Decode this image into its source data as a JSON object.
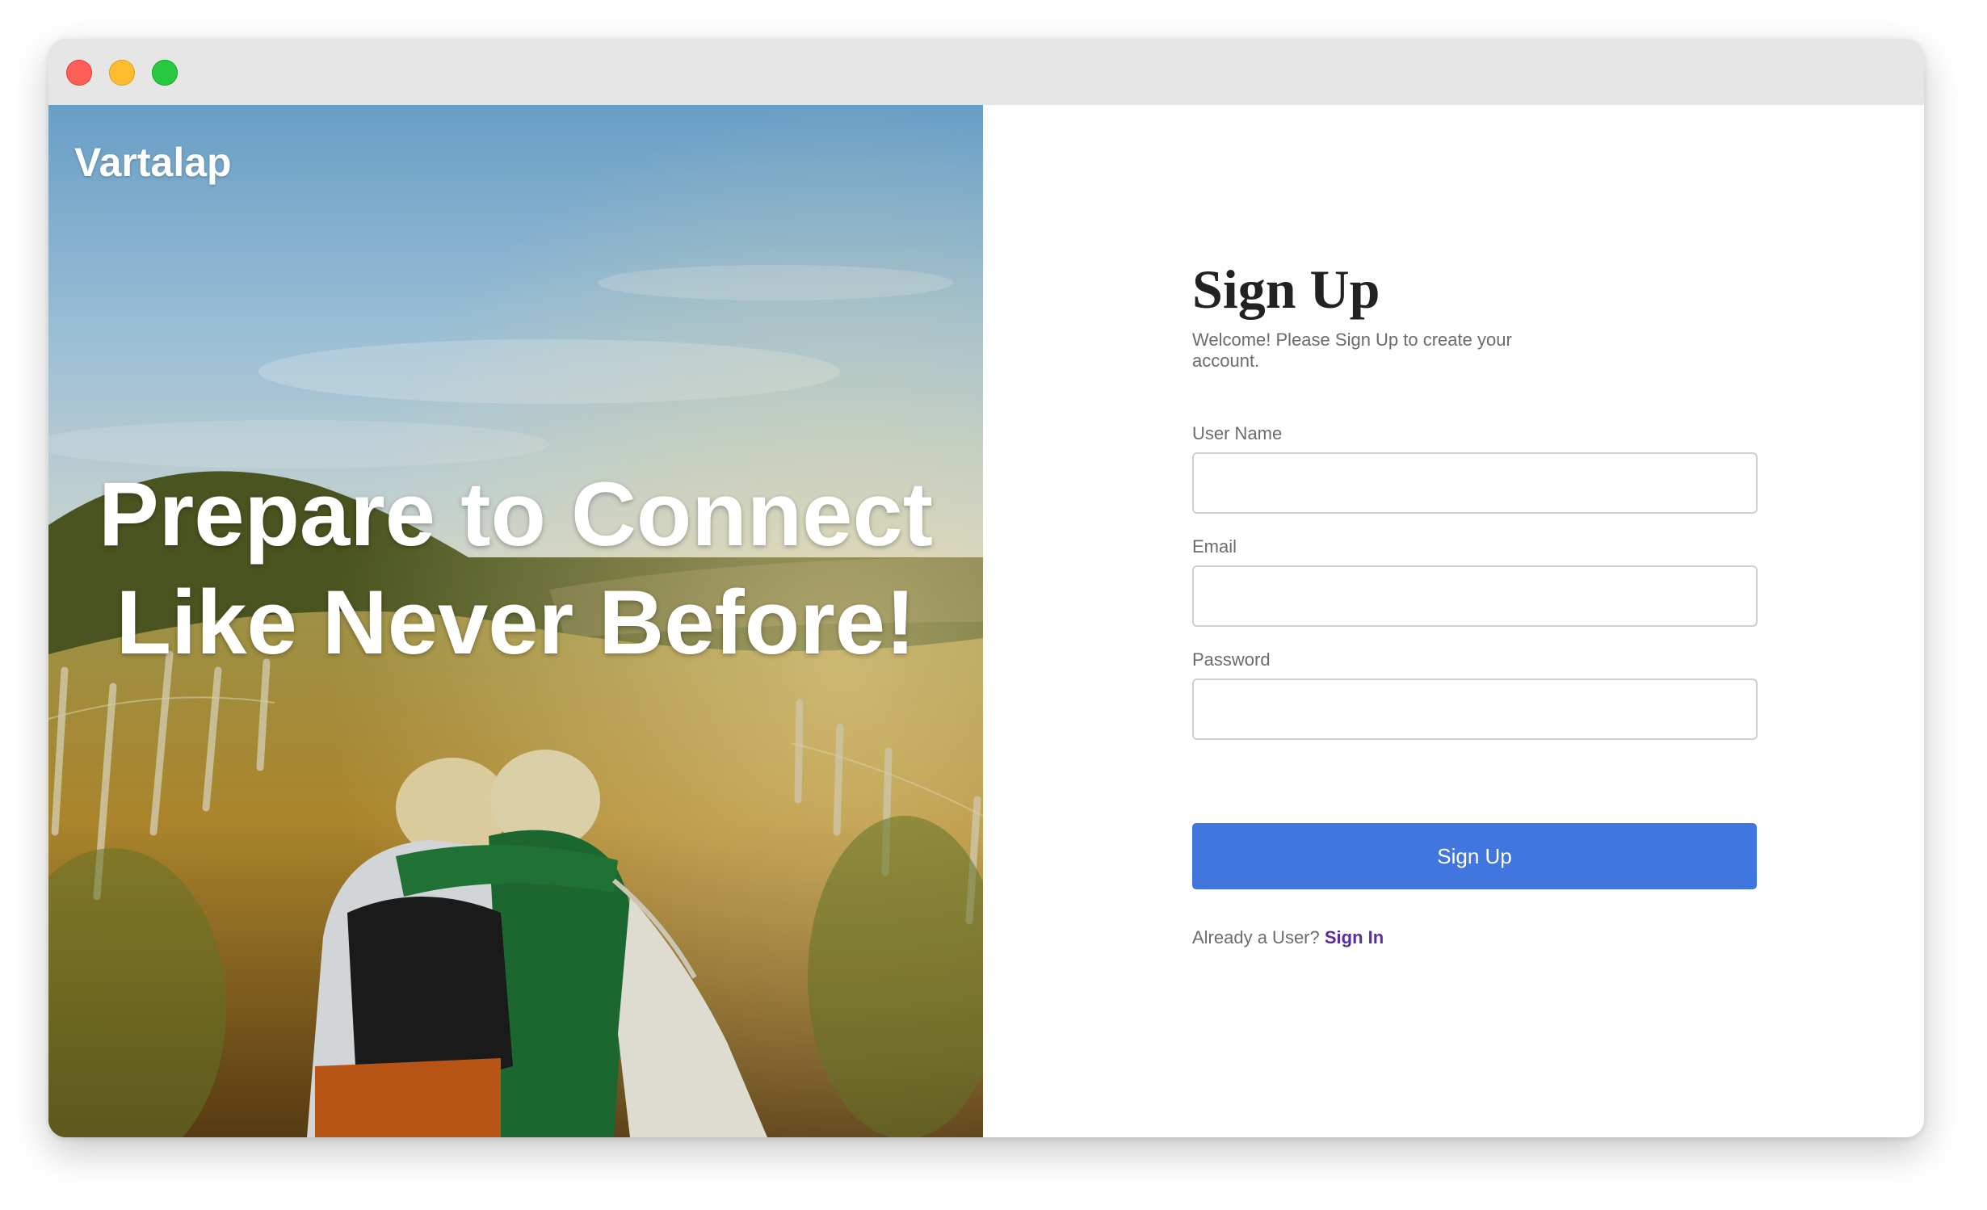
{
  "window": {
    "controls": [
      "close",
      "minimize",
      "maximize"
    ]
  },
  "hero": {
    "brand": "Vartalap",
    "headline": "Prepare to Connect Like Never Before!"
  },
  "form": {
    "title": "Sign Up",
    "subtitle": "Welcome! Please Sign Up to create your account.",
    "fields": {
      "username": {
        "label": "User Name",
        "value": "",
        "placeholder": ""
      },
      "email": {
        "label": "Email",
        "value": "",
        "placeholder": ""
      },
      "password": {
        "label": "Password",
        "value": "",
        "placeholder": ""
      }
    },
    "submit_label": "Sign Up",
    "signin_prompt": "Already a User?",
    "signin_link": "Sign In"
  },
  "colors": {
    "primary_button": "#4076dd",
    "link": "#5a2ca0",
    "title_text": "#222222",
    "muted_text": "#6c6c6c"
  }
}
